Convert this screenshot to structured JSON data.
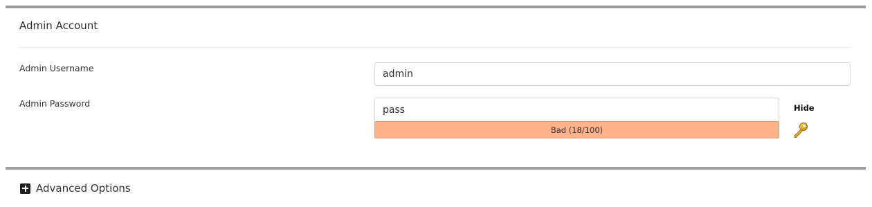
{
  "admin_account": {
    "title": "Admin Account",
    "username": {
      "label": "Admin Username",
      "value": "admin"
    },
    "password": {
      "label": "Admin Password",
      "value": "pass",
      "strength_text": "Bad (18/100)",
      "strength_score": 18,
      "strength_color": "#ffb28a",
      "toggle_label": "Hide"
    },
    "generate_icon": "key-icon"
  },
  "advanced": {
    "label": "Advanced Options",
    "icon": "plus-square-icon"
  }
}
